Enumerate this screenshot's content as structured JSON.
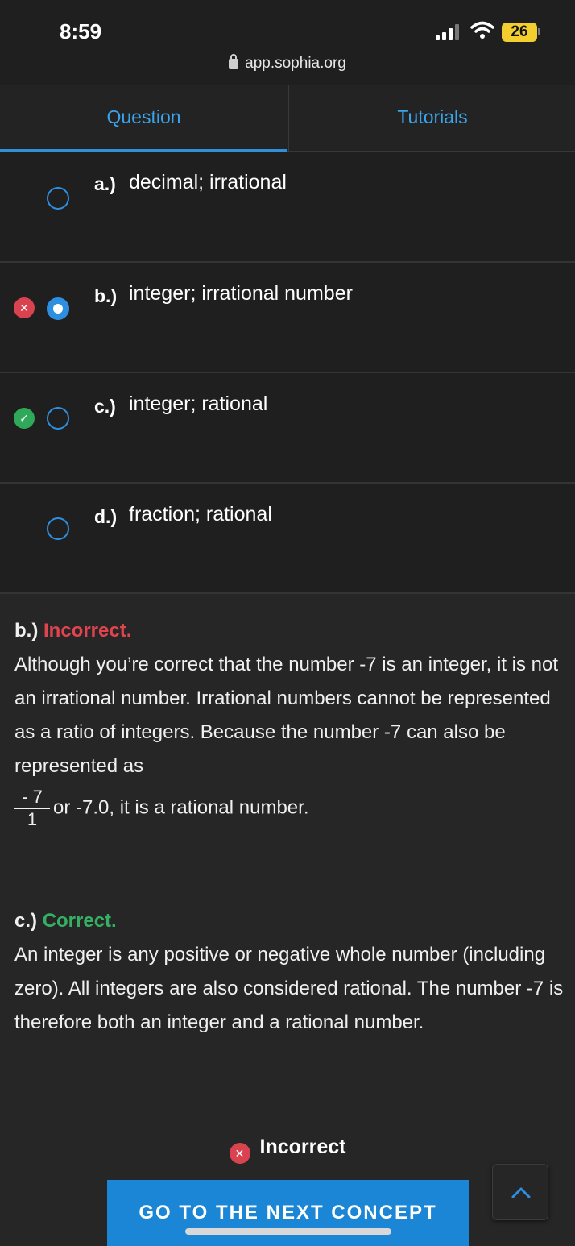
{
  "status": {
    "time": "8:59",
    "battery": "26"
  },
  "browser": {
    "url": "app.sophia.org"
  },
  "tabs": [
    {
      "label": "Question"
    },
    {
      "label": "Tutorials"
    }
  ],
  "options": [
    {
      "letter": "a.)",
      "text": "decimal; irrational",
      "selected": false,
      "result": null
    },
    {
      "letter": "b.)",
      "text": "integer; irrational number",
      "selected": true,
      "result": "incorrect"
    },
    {
      "letter": "c.)",
      "text": "integer; rational",
      "selected": false,
      "result": "correct"
    },
    {
      "letter": "d.)",
      "text": "fraction; rational",
      "selected": false,
      "result": null
    }
  ],
  "feedback": [
    {
      "letter": "b.)",
      "verdict": "Incorrect.",
      "body": "Although you’re correct that the number -7 is an integer, it is not an irrational number. Irrational numbers cannot be represented as a ratio of integers. Because the number -7 can also be represented as",
      "fraction_numerator": "- 7",
      "fraction_denominator": "1",
      "tail": "or -7.0, it is a rational number."
    },
    {
      "letter": "c.)",
      "verdict": "Correct.",
      "body": "An integer is any positive or negative whole number (including zero). All integers are also considered rational. The number -7 is therefore both an integer and a rational number."
    }
  ],
  "result_label": "Incorrect",
  "next_button_label": "GO TO THE NEXT CONCEPT",
  "colors": {
    "accent": "#1b86d6",
    "incorrect": "#e2444f",
    "correct": "#35b062"
  },
  "icons": {
    "incorrect": "x-circle-icon",
    "correct": "check-circle-icon",
    "scroll_top": "chevron-up-icon"
  }
}
